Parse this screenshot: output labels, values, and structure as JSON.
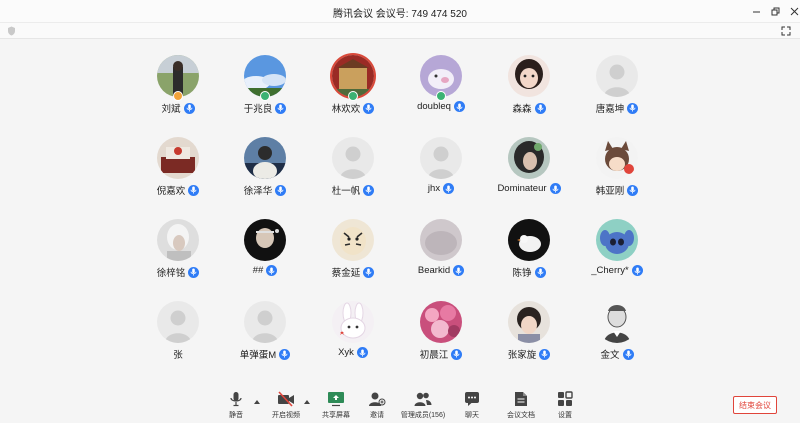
{
  "window": {
    "title": "腾讯会议  会议号: 749 474 520"
  },
  "participants": [
    {
      "name": "刘斌",
      "avatar": "photo-outdoor",
      "badge": "orange"
    },
    {
      "name": "于兆良",
      "avatar": "photo-sky",
      "badge": "green"
    },
    {
      "name": "林欢欢",
      "avatar": "photo-building",
      "badge": "green",
      "ring": "red"
    },
    {
      "name": "doubleq",
      "avatar": "cartoon-pig",
      "badge": "green"
    },
    {
      "name": "森森",
      "avatar": "photo-girl"
    },
    {
      "name": "唐嘉坤",
      "avatar": "default"
    },
    {
      "name": "倪嘉欢",
      "avatar": "photo-room"
    },
    {
      "name": "徐泽华",
      "avatar": "photo-person-blue"
    },
    {
      "name": "杜一帆",
      "avatar": "default"
    },
    {
      "name": "jhx",
      "avatar": "default"
    },
    {
      "name": "Dominateur",
      "avatar": "photo-dark-hair"
    },
    {
      "name": "韩亚刚",
      "avatar": "cartoon-catgirl"
    },
    {
      "name": "徐梓铭",
      "avatar": "photo-white-hair"
    },
    {
      "name": "##",
      "avatar": "photo-masked"
    },
    {
      "name": "蔡金延",
      "avatar": "cartoon-tiger"
    },
    {
      "name": "Bearkid",
      "avatar": "photo-blurred"
    },
    {
      "name": "陈铮",
      "avatar": "photo-bird"
    },
    {
      "name": "_Cherry*",
      "avatar": "cartoon-stitch"
    },
    {
      "name": "张",
      "avatar": "default",
      "nomic": true
    },
    {
      "name": "单弹蛋M",
      "avatar": "default"
    },
    {
      "name": "Xyk",
      "avatar": "cartoon-rabbit"
    },
    {
      "name": "初晨江",
      "avatar": "photo-flowers"
    },
    {
      "name": "张家旋",
      "avatar": "photo-child"
    },
    {
      "name": "金文",
      "avatar": "sketch-portrait"
    }
  ],
  "toolbar": {
    "mute": "静音",
    "video": "开启视频",
    "share": "共享屏幕",
    "invite": "邀请",
    "members": "管理成员(156)",
    "chat": "聊天",
    "docs": "会议文档",
    "settings": "设置",
    "end": "结束会议"
  },
  "colors": {
    "accent": "#2f7cf6",
    "danger": "#e0453b",
    "online": "#3bb273"
  }
}
